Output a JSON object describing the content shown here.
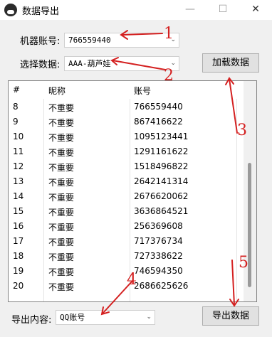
{
  "window": {
    "title": "数据导出",
    "min": "—",
    "max": "☐",
    "close": "✕"
  },
  "form": {
    "account_label": "机器账号:",
    "account_value": "766559440",
    "select_label": "选择数据:",
    "select_value": "AAA-葫芦娃",
    "load_button": "加载数据",
    "export_label": "导出内容:",
    "export_value": "QQ账号",
    "export_button": "导出数据"
  },
  "table": {
    "headers": [
      "#",
      "昵称",
      "账号"
    ],
    "rows": [
      [
        "8",
        "不重要",
        "766559440"
      ],
      [
        "9",
        "不重要",
        "867416622"
      ],
      [
        "10",
        "不重要",
        "1095123441"
      ],
      [
        "11",
        "不重要",
        "1291161622"
      ],
      [
        "12",
        "不重要",
        "1518496822"
      ],
      [
        "13",
        "不重要",
        "2642141314"
      ],
      [
        "14",
        "不重要",
        "2676620062"
      ],
      [
        "15",
        "不重要",
        "3636864521"
      ],
      [
        "16",
        "不重要",
        "256369608"
      ],
      [
        "17",
        "不重要",
        "717376734"
      ],
      [
        "18",
        "不重要",
        "727338622"
      ],
      [
        "19",
        "不重要",
        "746594350"
      ],
      [
        "20",
        "不重要",
        "2686625626"
      ]
    ]
  },
  "annotations": {
    "color": "#d42020",
    "labels": [
      "1",
      "2",
      "3",
      "4",
      "5"
    ]
  }
}
